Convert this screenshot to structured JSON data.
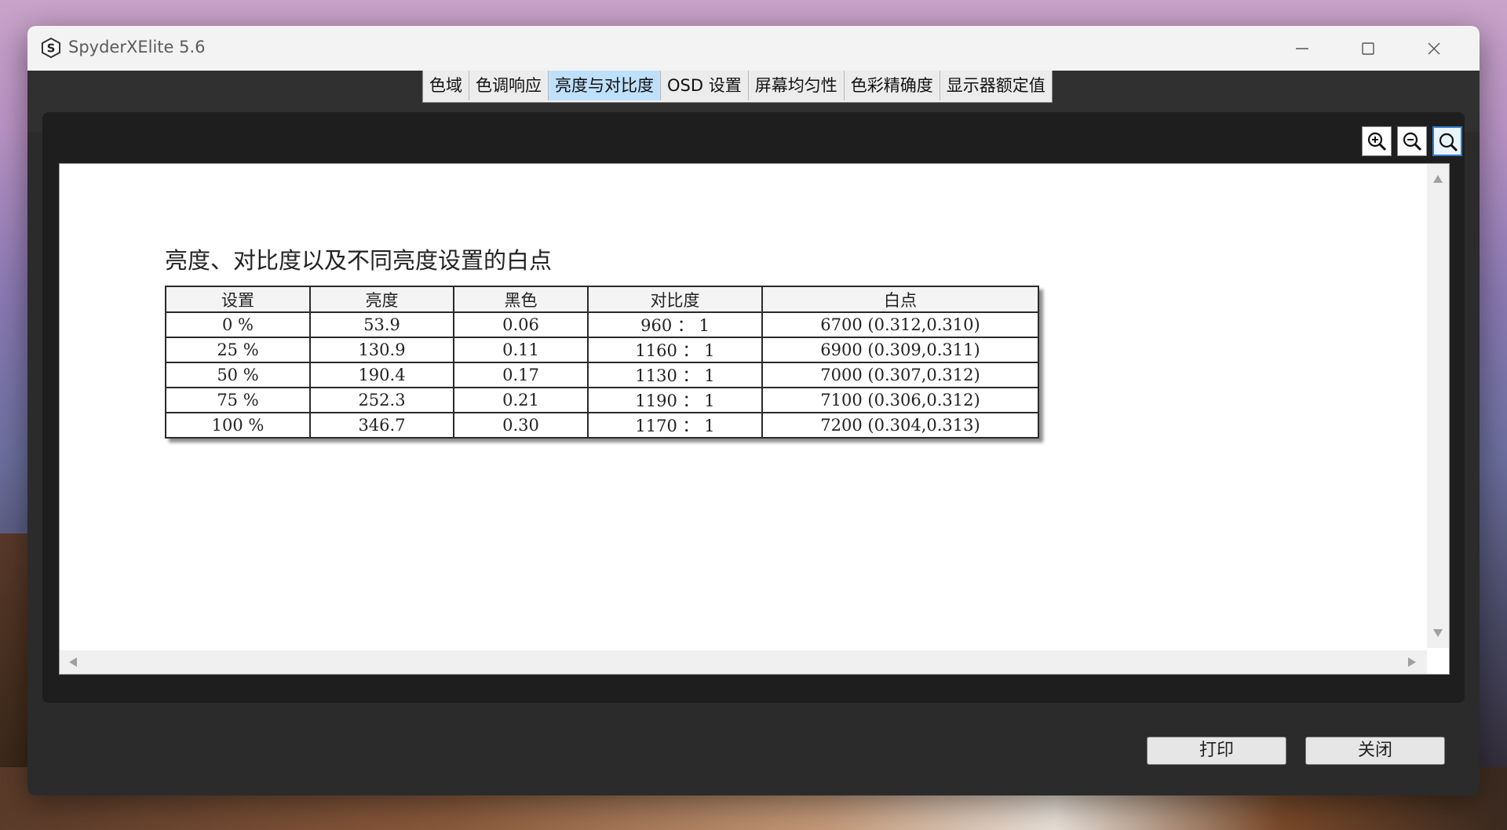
{
  "app": {
    "title": "SpyderXElite 5.6",
    "icon": "spyder-logo-icon",
    "icon_letter": "S"
  },
  "tabs": [
    {
      "label": "色域",
      "active": false
    },
    {
      "label": "色调响应",
      "active": false
    },
    {
      "label": "亮度与对比度",
      "active": true
    },
    {
      "label": "OSD 设置",
      "active": false
    },
    {
      "label": "屏幕均匀性",
      "active": false
    },
    {
      "label": "色彩精确度",
      "active": false
    },
    {
      "label": "显示器额定值",
      "active": false
    }
  ],
  "zoom_tools": [
    "zoom-in-icon",
    "zoom-out-icon",
    "zoom-fit-icon"
  ],
  "report": {
    "title": "亮度、对比度以及不同亮度设置的白点",
    "columns": [
      "设置",
      "亮度",
      "黑色",
      "对比度",
      "白点"
    ],
    "rows": [
      [
        "0 %",
        "53.9",
        "0.06",
        "960 ： 1",
        "6700 (0.312,0.310)"
      ],
      [
        "25 %",
        "130.9",
        "0.11",
        "1160 ： 1",
        "6900 (0.309,0.311)"
      ],
      [
        "50 %",
        "190.4",
        "0.17",
        "1130 ： 1",
        "7000 (0.307,0.312)"
      ],
      [
        "75 %",
        "252.3",
        "0.21",
        "1190 ： 1",
        "7100 (0.306,0.312)"
      ],
      [
        "100 %",
        "346.7",
        "0.30",
        "1170 ： 1",
        "7200 (0.304,0.313)"
      ]
    ]
  },
  "buttons": {
    "print": "打印",
    "close": "关闭"
  },
  "colors": {
    "active_tab": "#bfe0fb",
    "window_bg": "#2b2b2b",
    "titlebar_bg": "#f3f3f3"
  }
}
